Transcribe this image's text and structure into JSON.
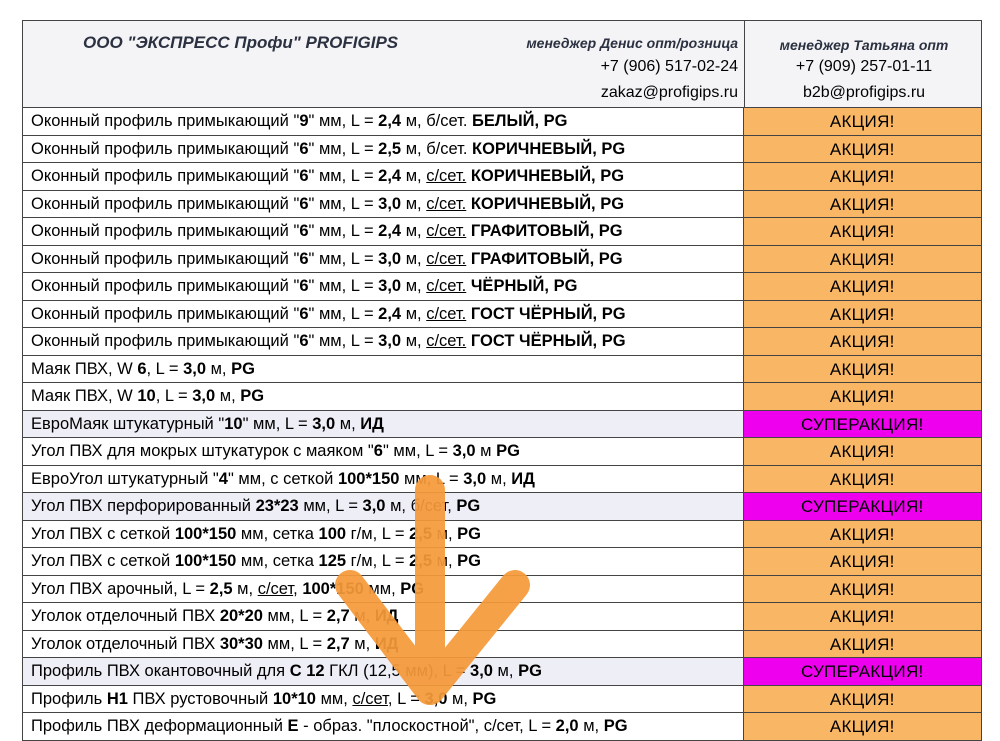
{
  "header": {
    "company": "ООО \"ЭКСПРЕСС Профи\"  PROFIGIPS",
    "manager1": "менеджер Денис опт/розница",
    "phone1": "+7 (906) 517-02-24",
    "email1": "zakaz@profigips.ru",
    "manager2": "менеджер Татьяна опт",
    "phone2": "+7 (909) 257-01-11",
    "email2": "b2b@profigips.ru"
  },
  "badges": {
    "akc": "АКЦИЯ!",
    "super": "СУПЕРАКЦИЯ!"
  },
  "colors": {
    "akc": "#f9b765",
    "super": "#ee00ee",
    "arrow": "#f59a3a"
  },
  "rows": [
    {
      "parts": [
        [
          "Оконный профиль примыкающий \"",
          ""
        ],
        [
          "9",
          "b"
        ],
        [
          "\" мм, L = ",
          ""
        ],
        [
          "2,4",
          "b"
        ],
        [
          " м, б/сет. ",
          ""
        ],
        [
          "БЕЛЫЙ, PG",
          "b"
        ]
      ],
      "badge": "akc",
      "hl": false
    },
    {
      "parts": [
        [
          "Оконный профиль примыкающий \"",
          ""
        ],
        [
          "6",
          "b"
        ],
        [
          "\" мм, L = ",
          ""
        ],
        [
          "2,5",
          "b"
        ],
        [
          " м, б/сет. ",
          ""
        ],
        [
          "КОРИЧНЕВЫЙ, PG",
          "b"
        ]
      ],
      "badge": "akc",
      "hl": false
    },
    {
      "parts": [
        [
          "Оконный профиль примыкающий \"",
          ""
        ],
        [
          "6",
          "b"
        ],
        [
          "\" мм, L = ",
          ""
        ],
        [
          "2,4",
          "b"
        ],
        [
          " м, ",
          ""
        ],
        [
          "с/сет.",
          "u"
        ],
        [
          " ",
          ""
        ],
        [
          "КОРИЧНЕВЫЙ, PG",
          "b"
        ]
      ],
      "badge": "akc",
      "hl": false
    },
    {
      "parts": [
        [
          "Оконный профиль примыкающий \"",
          ""
        ],
        [
          "6",
          "b"
        ],
        [
          "\" мм, L = ",
          ""
        ],
        [
          "3,0",
          "b"
        ],
        [
          " м, ",
          ""
        ],
        [
          "с/сет.",
          "u"
        ],
        [
          " ",
          ""
        ],
        [
          "КОРИЧНЕВЫЙ, PG",
          "b"
        ]
      ],
      "badge": "akc",
      "hl": false
    },
    {
      "parts": [
        [
          "Оконный профиль примыкающий \"",
          ""
        ],
        [
          "6",
          "b"
        ],
        [
          "\" мм, L = ",
          ""
        ],
        [
          "2,4",
          "b"
        ],
        [
          " м, ",
          ""
        ],
        [
          "с/сет.",
          "u"
        ],
        [
          " ",
          ""
        ],
        [
          "ГРАФИТОВЫЙ, PG",
          "b"
        ]
      ],
      "badge": "akc",
      "hl": false
    },
    {
      "parts": [
        [
          "Оконный профиль примыкающий \"",
          ""
        ],
        [
          "6",
          "b"
        ],
        [
          "\" мм, L = ",
          ""
        ],
        [
          "3,0",
          "b"
        ],
        [
          " м, ",
          ""
        ],
        [
          "с/сет.",
          "u"
        ],
        [
          " ",
          ""
        ],
        [
          "ГРАФИТОВЫЙ, PG",
          "b"
        ]
      ],
      "badge": "akc",
      "hl": false
    },
    {
      "parts": [
        [
          "Оконный профиль примыкающий \"",
          ""
        ],
        [
          "6",
          "b"
        ],
        [
          "\" мм, L = ",
          ""
        ],
        [
          "3,0",
          "b"
        ],
        [
          " м, ",
          ""
        ],
        [
          "с/сет.",
          "u"
        ],
        [
          " ",
          ""
        ],
        [
          "ЧЁРНЫЙ, PG",
          "b"
        ]
      ],
      "badge": "akc",
      "hl": false
    },
    {
      "parts": [
        [
          "Оконный профиль примыкающий \"",
          ""
        ],
        [
          "6",
          "b"
        ],
        [
          "\" мм, L = ",
          ""
        ],
        [
          "2,4",
          "b"
        ],
        [
          " м, ",
          ""
        ],
        [
          "с/сет.",
          "u"
        ],
        [
          " ",
          ""
        ],
        [
          "ГОСТ ЧЁРНЫЙ, PG",
          "b"
        ]
      ],
      "badge": "akc",
      "hl": false
    },
    {
      "parts": [
        [
          "Оконный профиль примыкающий \"",
          ""
        ],
        [
          "6",
          "b"
        ],
        [
          "\" мм, L = ",
          ""
        ],
        [
          "3,0",
          "b"
        ],
        [
          " м, ",
          ""
        ],
        [
          "с/сет.",
          "u"
        ],
        [
          " ",
          ""
        ],
        [
          "ГОСТ ЧЁРНЫЙ, PG",
          "b"
        ]
      ],
      "badge": "akc",
      "hl": false
    },
    {
      "parts": [
        [
          "Маяк ПВХ, W ",
          ""
        ],
        [
          "6",
          "b"
        ],
        [
          ", L = ",
          ""
        ],
        [
          "3,0",
          "b"
        ],
        [
          " м, ",
          ""
        ],
        [
          "PG",
          "b"
        ]
      ],
      "badge": "akc",
      "hl": false
    },
    {
      "parts": [
        [
          "Маяк ПВХ, W ",
          ""
        ],
        [
          "10",
          "b"
        ],
        [
          ", L = ",
          ""
        ],
        [
          "3,0",
          "b"
        ],
        [
          " м, ",
          ""
        ],
        [
          "PG",
          "b"
        ]
      ],
      "badge": "akc",
      "hl": false
    },
    {
      "parts": [
        [
          "ЕвроМаяк штукатурный \"",
          ""
        ],
        [
          "10",
          "b"
        ],
        [
          "\" мм, L = ",
          ""
        ],
        [
          "3,0",
          "b"
        ],
        [
          " м, ",
          ""
        ],
        [
          "ИД",
          "b"
        ]
      ],
      "badge": "super",
      "hl": true
    },
    {
      "parts": [
        [
          "Угол ПВХ для мокрых штукатурок с маяком \"",
          ""
        ],
        [
          "6",
          "b"
        ],
        [
          "\" мм, L = ",
          ""
        ],
        [
          "3,0",
          "b"
        ],
        [
          " м ",
          ""
        ],
        [
          "PG",
          "b"
        ]
      ],
      "badge": "akc",
      "hl": false
    },
    {
      "parts": [
        [
          "ЕвроУгол штукатурный \"",
          ""
        ],
        [
          "4",
          "b"
        ],
        [
          "\" мм, с сеткой ",
          ""
        ],
        [
          "100*150",
          "b"
        ],
        [
          " мм, L = ",
          ""
        ],
        [
          "3,0",
          "b"
        ],
        [
          " м, ",
          ""
        ],
        [
          "ИД",
          "b"
        ]
      ],
      "badge": "akc",
      "hl": false
    },
    {
      "parts": [
        [
          "Угол ПВХ перфорированный ",
          ""
        ],
        [
          "23*23",
          "b"
        ],
        [
          " мм, L = ",
          ""
        ],
        [
          "3,0",
          "b"
        ],
        [
          " м, б/сет, ",
          ""
        ],
        [
          "PG",
          "b"
        ]
      ],
      "badge": "super",
      "hl": true
    },
    {
      "parts": [
        [
          "Угол ПВХ с сеткой ",
          ""
        ],
        [
          "100*150",
          "b"
        ],
        [
          " мм, сетка ",
          ""
        ],
        [
          "100",
          "b"
        ],
        [
          " г/м, L = ",
          ""
        ],
        [
          "2,5",
          "b"
        ],
        [
          " м, ",
          ""
        ],
        [
          "PG",
          "b"
        ]
      ],
      "badge": "akc",
      "hl": false
    },
    {
      "parts": [
        [
          "Угол ПВХ с сеткой ",
          ""
        ],
        [
          "100*150",
          "b"
        ],
        [
          " мм, сетка ",
          ""
        ],
        [
          "125",
          "b"
        ],
        [
          " г/м, L = ",
          ""
        ],
        [
          "2,5",
          "b"
        ],
        [
          " м, ",
          ""
        ],
        [
          "PG",
          "b"
        ]
      ],
      "badge": "akc",
      "hl": false
    },
    {
      "parts": [
        [
          " Угол ПВХ арочный, L = ",
          ""
        ],
        [
          "2,5",
          "b"
        ],
        [
          " м, ",
          ""
        ],
        [
          "с/сет",
          "u"
        ],
        [
          ", ",
          ""
        ],
        [
          "100*150",
          "b"
        ],
        [
          " мм, ",
          ""
        ],
        [
          "PG",
          "b"
        ]
      ],
      "badge": "akc",
      "hl": false
    },
    {
      "parts": [
        [
          " Уголок отделочный ПВХ ",
          ""
        ],
        [
          "20*20",
          "b"
        ],
        [
          " мм, L = ",
          ""
        ],
        [
          "2,7",
          "b"
        ],
        [
          " м, ",
          ""
        ],
        [
          "ИД",
          "b"
        ]
      ],
      "badge": "akc",
      "hl": false
    },
    {
      "parts": [
        [
          " Уголок отделочный ПВХ ",
          ""
        ],
        [
          "30*30",
          "b"
        ],
        [
          " мм, L = ",
          ""
        ],
        [
          "2,7",
          "b"
        ],
        [
          " м, ",
          ""
        ],
        [
          "ИД",
          "b"
        ]
      ],
      "badge": "akc",
      "hl": false
    },
    {
      "parts": [
        [
          " Профиль ПВХ окантовочный для ",
          ""
        ],
        [
          "С 12",
          "b"
        ],
        [
          " ГКЛ (12,5 мм), L = ",
          ""
        ],
        [
          "3,0",
          "b"
        ],
        [
          " м, ",
          ""
        ],
        [
          "PG",
          "b"
        ]
      ],
      "badge": "super",
      "hl": true
    },
    {
      "parts": [
        [
          " Профиль ",
          ""
        ],
        [
          "Н1",
          "b"
        ],
        [
          " ПВХ рустовочный ",
          ""
        ],
        [
          "10*10",
          "b"
        ],
        [
          " мм, ",
          ""
        ],
        [
          "с/сет",
          "u"
        ],
        [
          ", L = ",
          ""
        ],
        [
          "3,0",
          "b"
        ],
        [
          " м, ",
          ""
        ],
        [
          "PG",
          "b"
        ]
      ],
      "badge": "akc",
      "hl": false
    },
    {
      "parts": [
        [
          " Профиль ПВХ деформационный ",
          ""
        ],
        [
          "Е",
          "b"
        ],
        [
          " - образ. \"плоскостной\", с/сет, L = ",
          ""
        ],
        [
          "2,0",
          "b"
        ],
        [
          " м, ",
          ""
        ],
        [
          "PG",
          "b"
        ]
      ],
      "badge": "akc",
      "hl": false
    }
  ]
}
